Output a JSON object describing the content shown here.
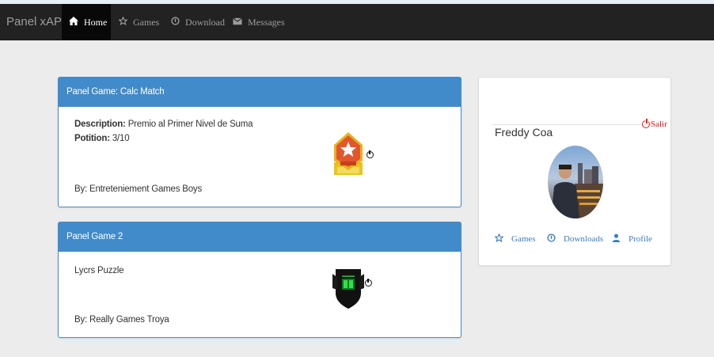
{
  "navbar": {
    "brand": "Panel xAPI",
    "items": [
      {
        "label": "Home",
        "icon": "home-icon",
        "active": true
      },
      {
        "label": "Games",
        "icon": "star-icon",
        "active": false
      },
      {
        "label": "Download",
        "icon": "download-circle-icon",
        "active": false
      },
      {
        "label": "Messages",
        "icon": "envelope-icon",
        "active": false
      }
    ]
  },
  "games": [
    {
      "title": "Panel Game: Calc Match",
      "description_label": "Description:",
      "description": "Premio al Primer Nivel de Suma",
      "position_label": "Potition:",
      "position": "3/10",
      "by": "By: Entreteniement Games Boys",
      "badge": "gold-star-badge-icon"
    },
    {
      "title": "Panel Game 2",
      "name": "Lycrs Puzzle",
      "by": "By: Really Games Troya",
      "badge": "dark-shield-badge-icon"
    }
  ],
  "profile": {
    "name": "Freddy Coa",
    "logout": "Salir",
    "links": [
      {
        "label": "Games",
        "icon": "star-outline-icon"
      },
      {
        "label": "Downloads",
        "icon": "download-circle-icon"
      },
      {
        "label": "Profile",
        "icon": "user-icon"
      }
    ]
  },
  "colors": {
    "navbar": "#222222",
    "primary": "#428bca",
    "link": "#3a7ebd",
    "danger": "#e21b1b",
    "background": "#ececec"
  }
}
